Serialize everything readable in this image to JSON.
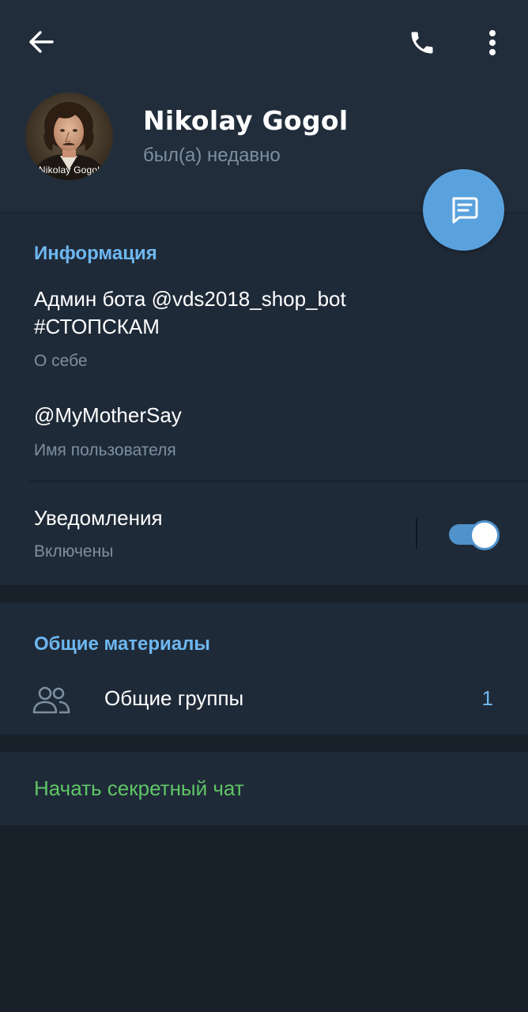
{
  "header": {
    "name": "Nikolay Gogol",
    "status": "был(а) недавно",
    "avatar_caption": "Nikolay Gogol",
    "icons": {
      "back": "arrow-left-icon",
      "call": "phone-icon",
      "more": "more-vertical-icon",
      "message": "message-icon"
    }
  },
  "info": {
    "title": "Информация",
    "bio_line1": "Админ бота @vds2018_shop_bot",
    "bio_line2": "#СТОПСКАМ",
    "bio_label": "О себе",
    "username": "@MyMotherSay",
    "username_label": "Имя пользователя",
    "notifications_label": "Уведомления",
    "notifications_status": "Включены",
    "notifications_enabled": true
  },
  "shared": {
    "title": "Общие материалы",
    "groups_label": "Общие группы",
    "groups_count": "1"
  },
  "secret": {
    "label": "Начать секретный чат"
  },
  "colors": {
    "header_bg": "#212d3b",
    "card_bg": "#1f2a38",
    "page_bg": "#18202a",
    "accent": "#6eb7f0",
    "fab": "#5aa2dd",
    "green": "#5fc567",
    "muted": "#7e8f9f"
  }
}
